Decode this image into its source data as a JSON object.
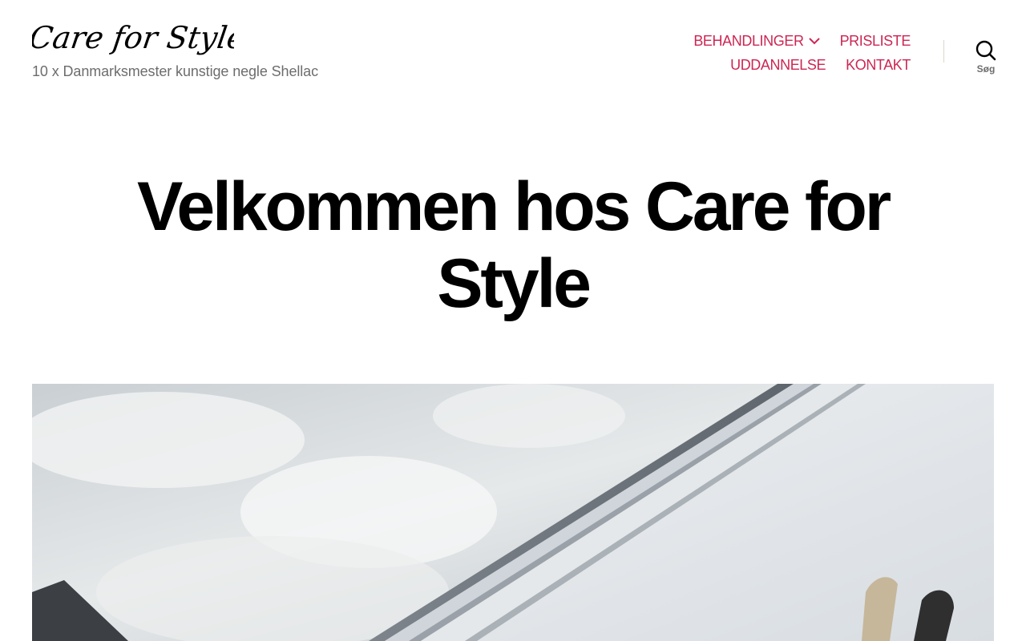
{
  "site": {
    "logo_text": "Care for Style",
    "tagline": "10 x Danmarksmester kunstige negle Shellac"
  },
  "nav": {
    "items": [
      {
        "label": "BEHANDLINGER",
        "has_submenu": true
      },
      {
        "label": "PRISLISTE"
      },
      {
        "label": "UDDANNELSE"
      },
      {
        "label": "KONTAKT"
      }
    ]
  },
  "search": {
    "label": "Søg",
    "icon": "search-icon"
  },
  "page": {
    "title": "Velkommen hos Care for Style"
  },
  "colors": {
    "accent": "#cd2653",
    "text_secondary": "#6d6d6d",
    "background": "#ffffff"
  }
}
